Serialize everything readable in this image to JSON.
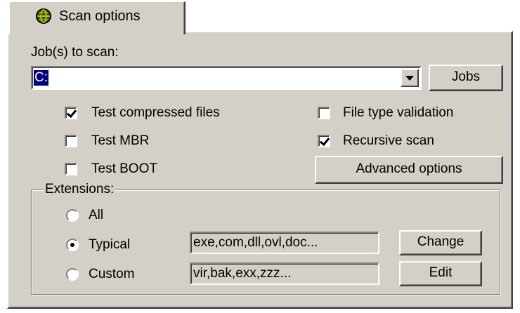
{
  "tab": {
    "label": "Scan options",
    "icon": "globe-scan-icon"
  },
  "jobs": {
    "label": "Job(s) to scan:",
    "selected_value": "C:",
    "jobs_button": "Jobs"
  },
  "options": {
    "test_compressed": {
      "label": "Test compressed files",
      "checked": true
    },
    "test_mbr": {
      "label": "Test MBR",
      "checked": false
    },
    "test_boot": {
      "label": "Test BOOT",
      "checked": false
    },
    "file_type_validation": {
      "label": "File type validation",
      "checked": false
    },
    "recursive_scan": {
      "label": "Recursive scan",
      "checked": true
    },
    "advanced_button": "Advanced options"
  },
  "extensions": {
    "title": "Extensions:",
    "all": {
      "label": "All",
      "selected": false
    },
    "typical": {
      "label": "Typical",
      "selected": true,
      "value": "exe,com,dll,ovl,doc...",
      "button": "Change"
    },
    "custom": {
      "label": "Custom",
      "selected": false,
      "value": "vir,bak,exx,zzz...",
      "button": "Edit"
    }
  },
  "colors": {
    "face": "#d4d0c8",
    "highlight": "#ffffff",
    "shadow": "#808080",
    "dark_shadow": "#404040",
    "selection": "#000080"
  }
}
